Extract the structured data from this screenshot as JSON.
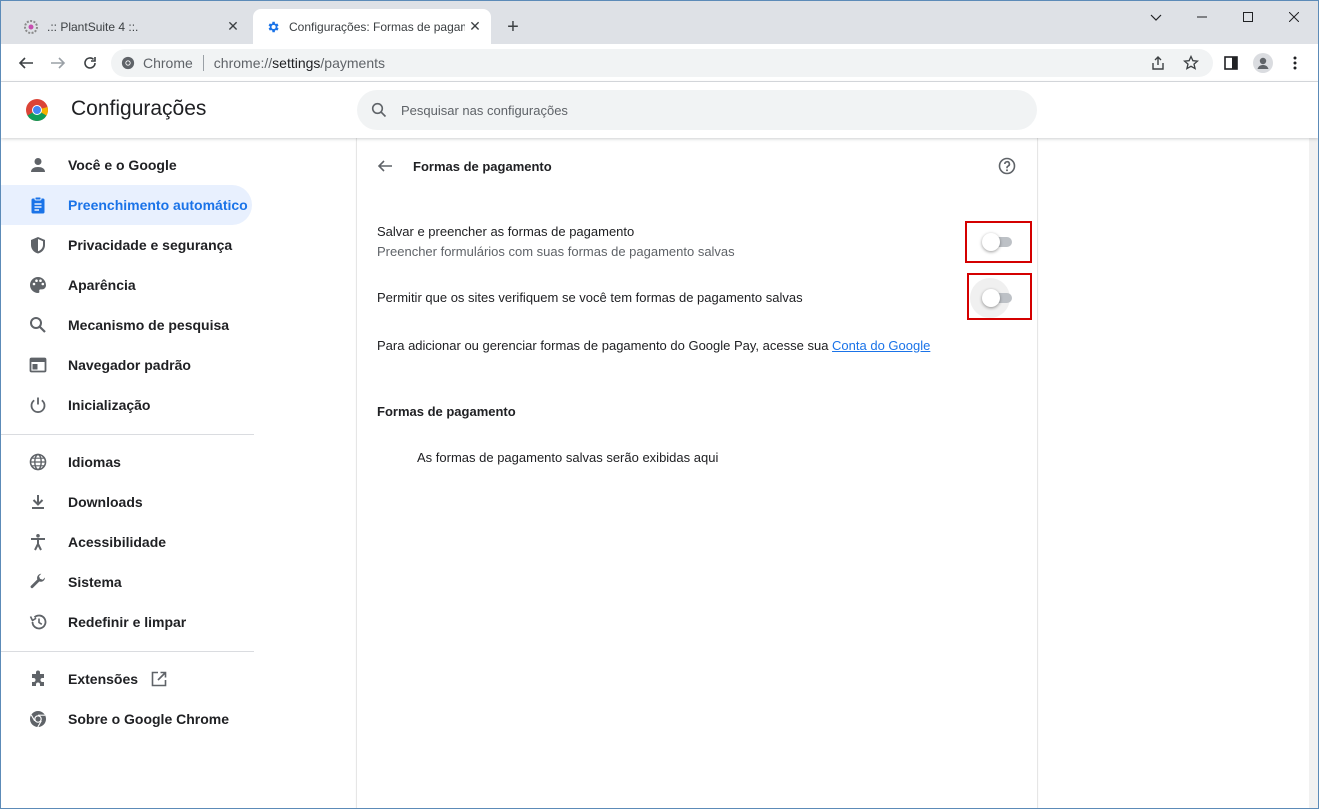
{
  "tabs": [
    {
      "title": ".:: PlantSuite 4 ::.",
      "active": false
    },
    {
      "title": "Configurações: Formas de pagamento",
      "active": true
    }
  ],
  "omnibox": {
    "site_label": "Chrome",
    "url_prefix": "chrome://",
    "url_main": "settings",
    "url_rest": "/payments"
  },
  "header": {
    "title": "Configurações",
    "search_placeholder": "Pesquisar nas configurações"
  },
  "sidebar": {
    "items": [
      {
        "label": "Você e o Google",
        "icon": "person-icon"
      },
      {
        "label": "Preenchimento automático",
        "icon": "clipboard-icon",
        "selected": true
      },
      {
        "label": "Privacidade e segurança",
        "icon": "shield-icon"
      },
      {
        "label": "Aparência",
        "icon": "palette-icon"
      },
      {
        "label": "Mecanismo de pesquisa",
        "icon": "search-icon"
      },
      {
        "label": "Navegador padrão",
        "icon": "browser-window-icon"
      },
      {
        "label": "Inicialização",
        "icon": "power-icon"
      },
      {
        "label": "Idiomas",
        "icon": "globe-icon"
      },
      {
        "label": "Downloads",
        "icon": "download-icon"
      },
      {
        "label": "Acessibilidade",
        "icon": "accessibility-icon"
      },
      {
        "label": "Sistema",
        "icon": "wrench-icon"
      },
      {
        "label": "Redefinir e limpar",
        "icon": "restore-icon"
      },
      {
        "label": "Extensões",
        "icon": "puzzle-icon"
      },
      {
        "label": "Sobre o Google Chrome",
        "icon": "chrome-icon"
      }
    ]
  },
  "page": {
    "title": "Formas de pagamento",
    "save_fill_label": "Salvar e preencher as formas de pagamento",
    "save_fill_sub": "Preencher formulários com suas formas de pagamento salvas",
    "allow_check_label": "Permitir que os sites verifiquem se você tem formas de pagamento salvas",
    "gpay_text": "Para adicionar ou gerenciar formas de pagamento do Google Pay, acesse sua ",
    "gpay_link": "Conta do Google",
    "section_title": "Formas de pagamento",
    "empty_text": "As formas de pagamento salvas serão exibidas aqui"
  },
  "toggles": {
    "save_fill": false,
    "allow_check": false
  },
  "colors": {
    "accent": "#1a73e8",
    "highlight_box": "#d40000",
    "selected_bg": "#e8f0fe"
  }
}
